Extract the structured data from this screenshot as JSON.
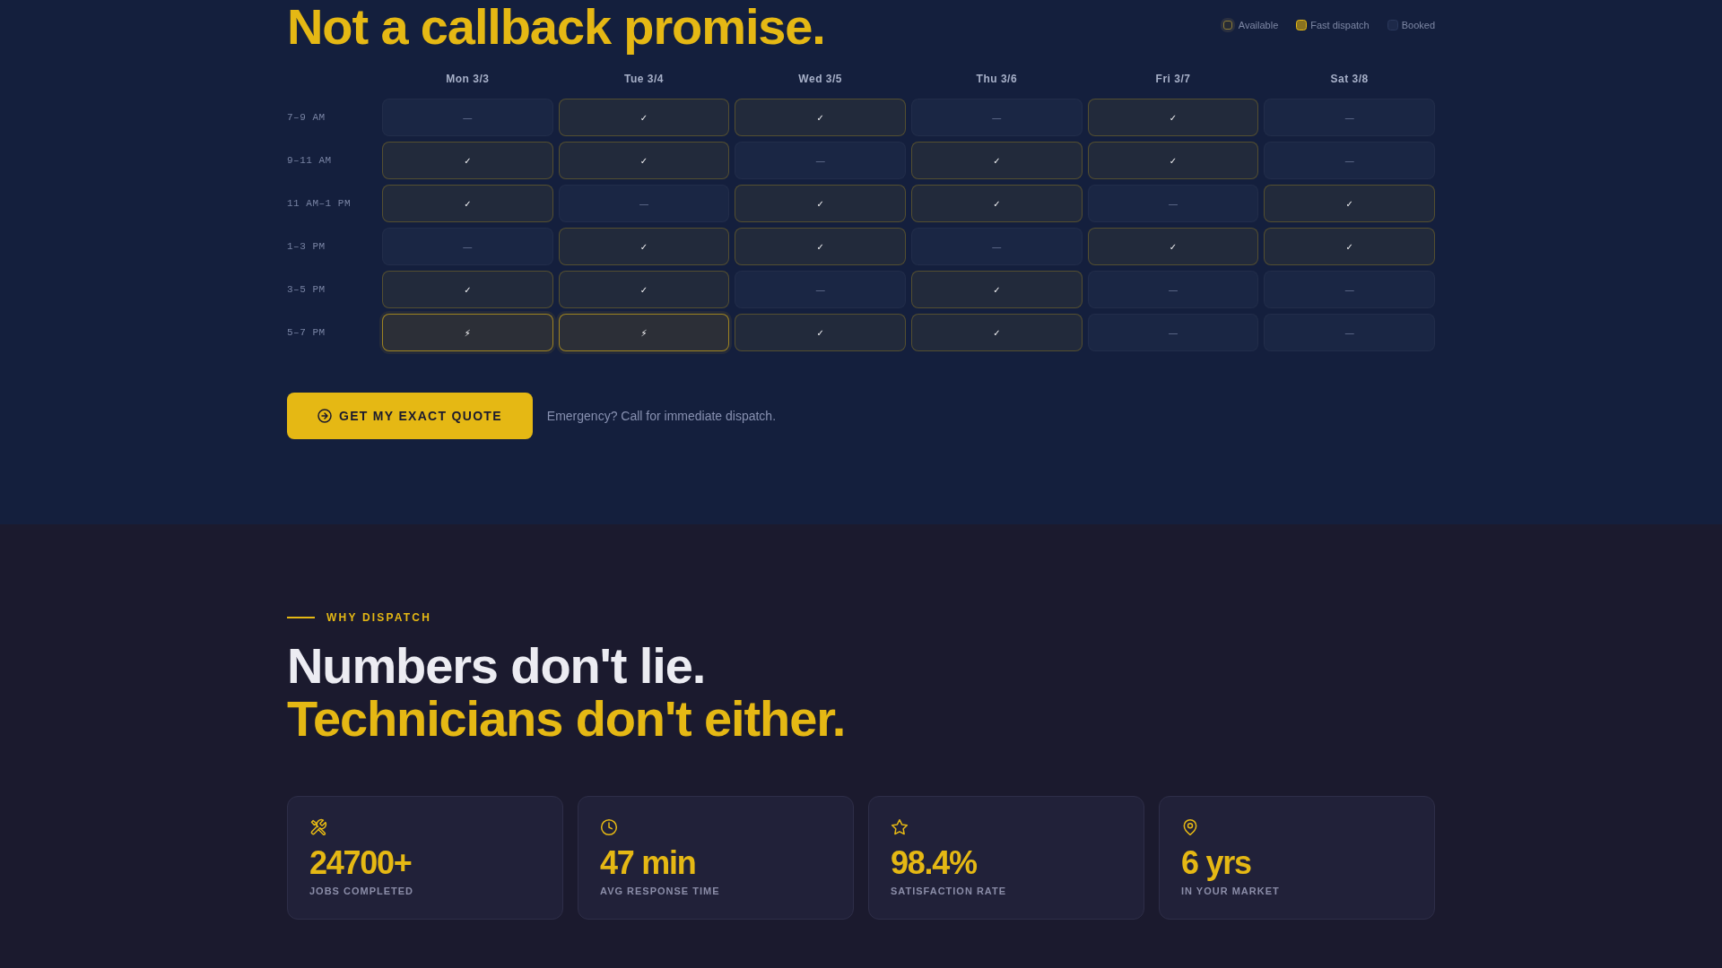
{
  "schedule": {
    "heading": "Not a callback promise.",
    "legend": [
      {
        "kind": "available",
        "label": "Available"
      },
      {
        "kind": "fast",
        "label": "Fast dispatch"
      },
      {
        "kind": "booked",
        "label": "Booked"
      }
    ],
    "days": [
      "Mon 3/3",
      "Tue 3/4",
      "Wed 3/5",
      "Thu 3/6",
      "Fri 3/7",
      "Sat 3/8"
    ],
    "rows": [
      {
        "time": "7–9 AM",
        "cells": [
          {
            "kind": "booked",
            "mark": "—"
          },
          {
            "kind": "available",
            "mark": "✓"
          },
          {
            "kind": "available",
            "mark": "✓"
          },
          {
            "kind": "booked",
            "mark": "—"
          },
          {
            "kind": "available",
            "mark": "✓"
          },
          {
            "kind": "booked",
            "mark": "—"
          }
        ]
      },
      {
        "time": "9–11 AM",
        "cells": [
          {
            "kind": "available",
            "mark": "✓"
          },
          {
            "kind": "available",
            "mark": "✓"
          },
          {
            "kind": "booked",
            "mark": "—"
          },
          {
            "kind": "available",
            "mark": "✓"
          },
          {
            "kind": "available",
            "mark": "✓"
          },
          {
            "kind": "booked",
            "mark": "—"
          }
        ]
      },
      {
        "time": "11 AM–1 PM",
        "cells": [
          {
            "kind": "available",
            "mark": "✓"
          },
          {
            "kind": "booked",
            "mark": "—"
          },
          {
            "kind": "available",
            "mark": "✓"
          },
          {
            "kind": "available",
            "mark": "✓"
          },
          {
            "kind": "booked",
            "mark": "—"
          },
          {
            "kind": "available",
            "mark": "✓"
          }
        ]
      },
      {
        "time": "1–3 PM",
        "cells": [
          {
            "kind": "booked",
            "mark": "—"
          },
          {
            "kind": "available",
            "mark": "✓"
          },
          {
            "kind": "available",
            "mark": "✓"
          },
          {
            "kind": "booked",
            "mark": "—"
          },
          {
            "kind": "available",
            "mark": "✓"
          },
          {
            "kind": "available",
            "mark": "✓"
          }
        ]
      },
      {
        "time": "3–5 PM",
        "cells": [
          {
            "kind": "available",
            "mark": "✓"
          },
          {
            "kind": "available",
            "mark": "✓"
          },
          {
            "kind": "booked",
            "mark": "—"
          },
          {
            "kind": "available",
            "mark": "✓"
          },
          {
            "kind": "booked",
            "mark": "—"
          },
          {
            "kind": "booked",
            "mark": "—"
          }
        ]
      },
      {
        "time": "5–7 PM",
        "cells": [
          {
            "kind": "fast",
            "mark": "⚡"
          },
          {
            "kind": "fast",
            "mark": "⚡"
          },
          {
            "kind": "available",
            "mark": "✓"
          },
          {
            "kind": "available",
            "mark": "✓"
          },
          {
            "kind": "booked",
            "mark": "—"
          },
          {
            "kind": "booked",
            "mark": "—"
          }
        ]
      }
    ]
  },
  "cta": {
    "button": "GET MY EXACT QUOTE",
    "note": "Emergency? Call for immediate dispatch."
  },
  "why_dispatch": {
    "eyebrow": "WHY DISPATCH",
    "title": "Numbers don't lie.",
    "title_accent": "Technicians don't either.",
    "stats": [
      {
        "value": "24700+",
        "label": "JOBS COMPLETED"
      },
      {
        "value": "47 min",
        "label": "AVG RESPONSE TIME"
      },
      {
        "value": "98.4%",
        "label": "SATISFACTION RATE"
      },
      {
        "value": "6 yrs",
        "label": "IN YOUR MARKET"
      }
    ]
  }
}
